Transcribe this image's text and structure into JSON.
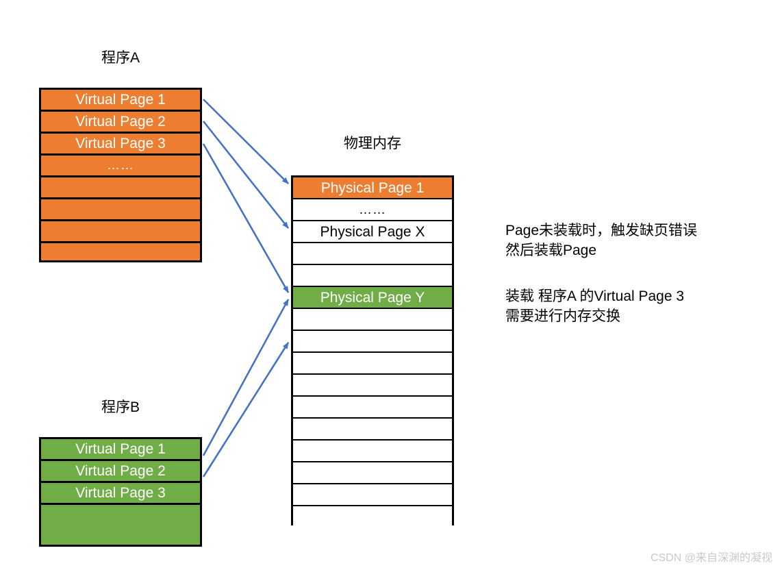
{
  "program_a": {
    "title": "程序A",
    "rows": [
      {
        "label": "Virtual Page 1"
      },
      {
        "label": "Virtual Page 2"
      },
      {
        "label": "Virtual Page 3"
      },
      {
        "label": "……"
      },
      {
        "label": ""
      },
      {
        "label": ""
      },
      {
        "label": ""
      },
      {
        "label": ""
      }
    ],
    "color": "#ED7D31"
  },
  "program_b": {
    "title": "程序B",
    "rows": [
      {
        "label": "Virtual Page 1"
      },
      {
        "label": "Virtual Page 2"
      },
      {
        "label": "Virtual Page 3"
      },
      {
        "label": ""
      }
    ],
    "color": "#70AD47"
  },
  "physical_memory": {
    "title": "物理内存",
    "rows": [
      {
        "label": "Physical Page 1",
        "fill": "orange"
      },
      {
        "label": "……",
        "fill": "none"
      },
      {
        "label": "Physical Page X",
        "fill": "none"
      },
      {
        "label": "",
        "fill": "none"
      },
      {
        "label": "",
        "fill": "none"
      },
      {
        "label": "Physical Page Y",
        "fill": "green"
      },
      {
        "label": "",
        "fill": "none"
      },
      {
        "label": "",
        "fill": "none"
      },
      {
        "label": "",
        "fill": "none"
      },
      {
        "label": "",
        "fill": "none"
      },
      {
        "label": "",
        "fill": "none"
      },
      {
        "label": "",
        "fill": "none"
      },
      {
        "label": "",
        "fill": "none"
      },
      {
        "label": "",
        "fill": "none"
      },
      {
        "label": "",
        "fill": "none"
      },
      {
        "label": "",
        "fill": "none"
      }
    ]
  },
  "notes": {
    "page_fault": "Page未装载时，触发缺页错误\n然后装载Page",
    "memory_swap": "装载 程序A 的Virtual Page 3\n需要进行内存交换"
  },
  "arrow_color": "#4472C4",
  "watermark": "CSDN @来自深渊的凝视"
}
